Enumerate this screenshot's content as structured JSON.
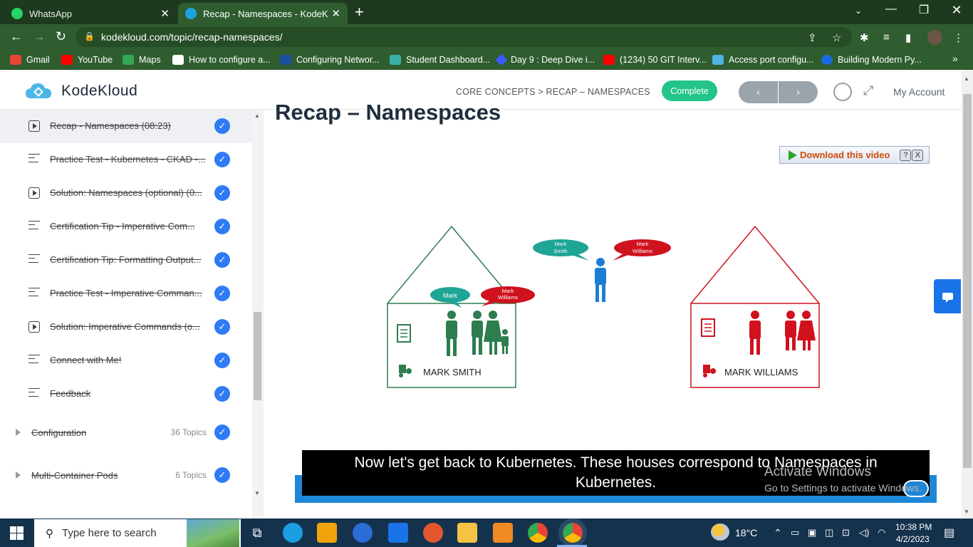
{
  "browser": {
    "tabs": [
      {
        "title": "WhatsApp",
        "active": false,
        "favicon_color": "#25d366"
      },
      {
        "title": "Recap - Namespaces - KodeKlou",
        "active": true,
        "favicon_color": "#1fa3e0"
      }
    ],
    "new_tab_label": "+",
    "url": "kodekloud.com/topic/recap-namespaces/",
    "bookmarks": [
      {
        "label": "Gmail",
        "color": "#ea4335"
      },
      {
        "label": "YouTube",
        "color": "#ff0000"
      },
      {
        "label": "Maps",
        "color": "#34a853"
      },
      {
        "label": "How to configure a...",
        "color": "#ffffff"
      },
      {
        "label": "Configuring Networ...",
        "color": "#1a4fa0"
      },
      {
        "label": "Student Dashboard...",
        "color": "#3ab0a8"
      },
      {
        "label": "Day 9 : Deep Dive i...",
        "color": "#3b5bff"
      },
      {
        "label": "(1234) 50 GIT Interv...",
        "color": "#ff0000"
      },
      {
        "label": "Access port configu...",
        "color": "#4fb3e8"
      },
      {
        "label": "Building Modern Py...",
        "color": "#1a6be0"
      }
    ]
  },
  "site": {
    "logo_text": "KodeKloud",
    "breadcrumb": "CORE CONCEPTS > RECAP – NAMESPACES",
    "complete_label": "Complete",
    "prev_label": "‹",
    "next_label": "›",
    "account_label": "My Account",
    "accent_color": "#22c489"
  },
  "sidebar": {
    "topics": [
      {
        "label": "Recap - Namespaces (08:23)",
        "icon": "play-icon",
        "selected": true
      },
      {
        "label": "Practice Test - Kubernetes - CKAD -...",
        "icon": "lines-icon"
      },
      {
        "label": "Solution: Namespaces (optional) (0...",
        "icon": "play-icon"
      },
      {
        "label": "Certification Tip - Imperative Com...",
        "icon": "lines-icon"
      },
      {
        "label": "Certification Tip: Formatting Output...",
        "icon": "lines-icon"
      },
      {
        "label": "Practice Test - Imperative Comman...",
        "icon": "lines-icon"
      },
      {
        "label": "Solution: Imperative Commands (o...",
        "icon": "play-icon"
      },
      {
        "label": "Connect with Me!",
        "icon": "lines-icon"
      },
      {
        "label": "Feedback",
        "icon": "lines-icon"
      }
    ],
    "modules": [
      {
        "label": "Configuration",
        "count": "36 Topics"
      },
      {
        "label": "Multi-Container Pods",
        "count": "6 Topics"
      }
    ]
  },
  "lesson": {
    "title": "Recap – Namespaces",
    "download_label": "Download this video",
    "help_label": "?",
    "close_label": "X",
    "caption_line1": "Now let's get back to Kubernetes. These houses correspond to Namespaces in",
    "caption_line2": "Kubernetes.",
    "diagram": {
      "house_left_name": "MARK SMITH",
      "house_right_name": "MARK WILLIAMS",
      "bubble_mark": "Mark",
      "bubble_mark_williams_1": "Mark",
      "bubble_mark_williams_2": "Williams",
      "bubble_mark_smith_1": "Mark",
      "bubble_mark_smith_2": "Smith",
      "green": "#2e7d4f",
      "red": "#d0121f",
      "teal": "#1ea596",
      "blue": "#1a7fd4"
    }
  },
  "watermark": {
    "line1": "Activate Windows",
    "line2": "Go to Settings to activate Windows."
  },
  "taskbar": {
    "search_placeholder": "Type here to search",
    "weather": "18°C",
    "time": "10:38 PM",
    "date": "4/2/2023"
  }
}
